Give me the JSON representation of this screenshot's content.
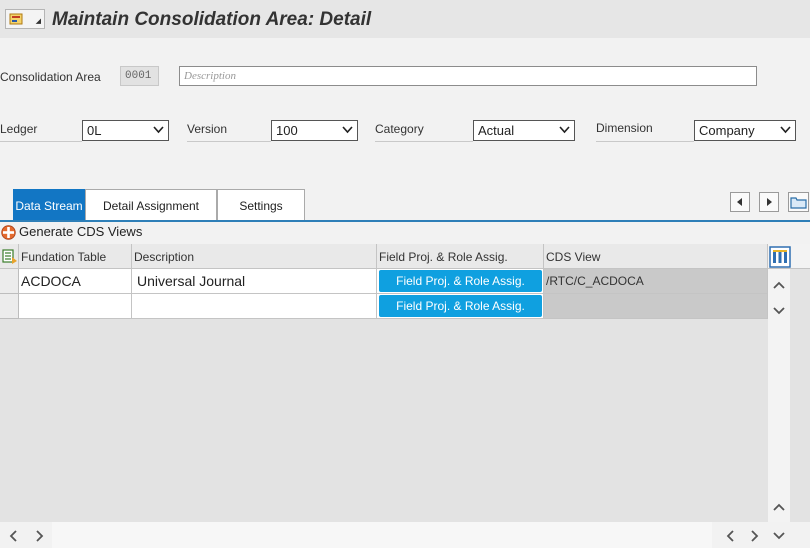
{
  "header": {
    "title": "Maintain Consolidation Area: Detail",
    "menu_icon": "menu-icon"
  },
  "area": {
    "label": "Consolidation Area",
    "value": "0001",
    "description_placeholder": "Description"
  },
  "fields": {
    "ledger": {
      "label": "Ledger",
      "value": "0L"
    },
    "version": {
      "label": "Version",
      "value": "100"
    },
    "category": {
      "label": "Category",
      "value": "Actual"
    },
    "dimension": {
      "label": "Dimension",
      "value": "Company"
    }
  },
  "tabs": [
    {
      "label": "Data Stream",
      "active": true
    },
    {
      "label": "Detail Assignment",
      "active": false
    },
    {
      "label": "Settings",
      "active": false
    }
  ],
  "toolbar": {
    "generate_label": "Generate CDS Views"
  },
  "table": {
    "columns": [
      "Fundation Table",
      "Description",
      "Field Proj. & Role Assig.",
      "CDS View"
    ],
    "rows": [
      {
        "table": "ACDOCA",
        "description": "Universal Journal",
        "button": "Field Proj. & Role Assig.",
        "cds_view": "/RTC/C_ACDOCA"
      },
      {
        "table": "",
        "description": "",
        "button": "Field Proj. & Role Assig.",
        "cds_view": ""
      }
    ]
  },
  "colors": {
    "accent": "#1276c4",
    "button": "#0fa0e0"
  }
}
